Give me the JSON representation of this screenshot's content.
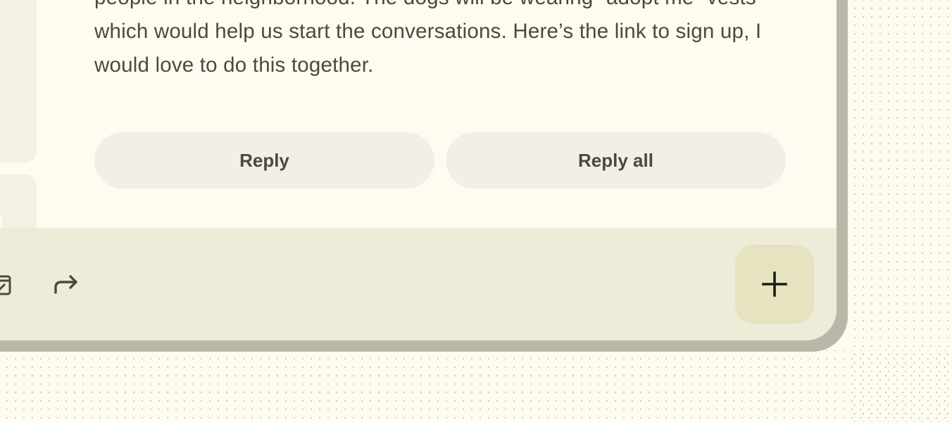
{
  "email": {
    "body": "people in the neighborhood. The dogs will be wearing “adopt me” vests which would help us start the conversations. Here’s the link to sign up, I would love to do this together."
  },
  "actions": {
    "reply_label": "Reply",
    "reply_all_label": "Reply all"
  },
  "bottom_bar": {
    "icons": [
      "archive-icon",
      "forward-icon"
    ],
    "fab_icon": "plus-icon"
  },
  "colors": {
    "background": "#fffbf0",
    "surface": "#fffbf0",
    "bottom_bar": "#eeecd9",
    "fab": "#e5e3c0",
    "button": "#f2efe8",
    "text": "#4b4a3c"
  }
}
